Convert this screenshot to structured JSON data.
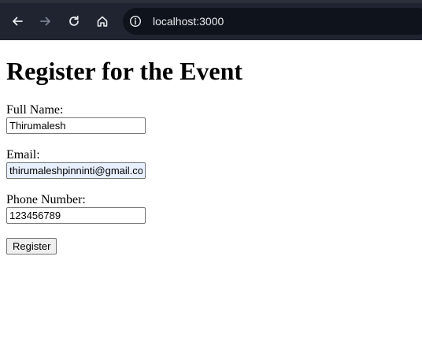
{
  "browser": {
    "back_icon": "arrow-left-icon",
    "forward_icon": "arrow-right-icon",
    "reload_icon": "reload-icon",
    "home_icon": "home-icon",
    "site_info_icon": "info-icon",
    "url": "localhost:3000",
    "toolbar_color": "#1f2430",
    "omnibox_color": "#0f131b"
  },
  "form": {
    "title": "Register for the Event",
    "full_name": {
      "label": "Full Name:",
      "value": "Thirumalesh"
    },
    "email": {
      "label": "Email:",
      "value": "thirumaleshpinninti@gmail.com"
    },
    "phone": {
      "label": "Phone Number:",
      "value": "123456789"
    },
    "submit_label": "Register"
  }
}
